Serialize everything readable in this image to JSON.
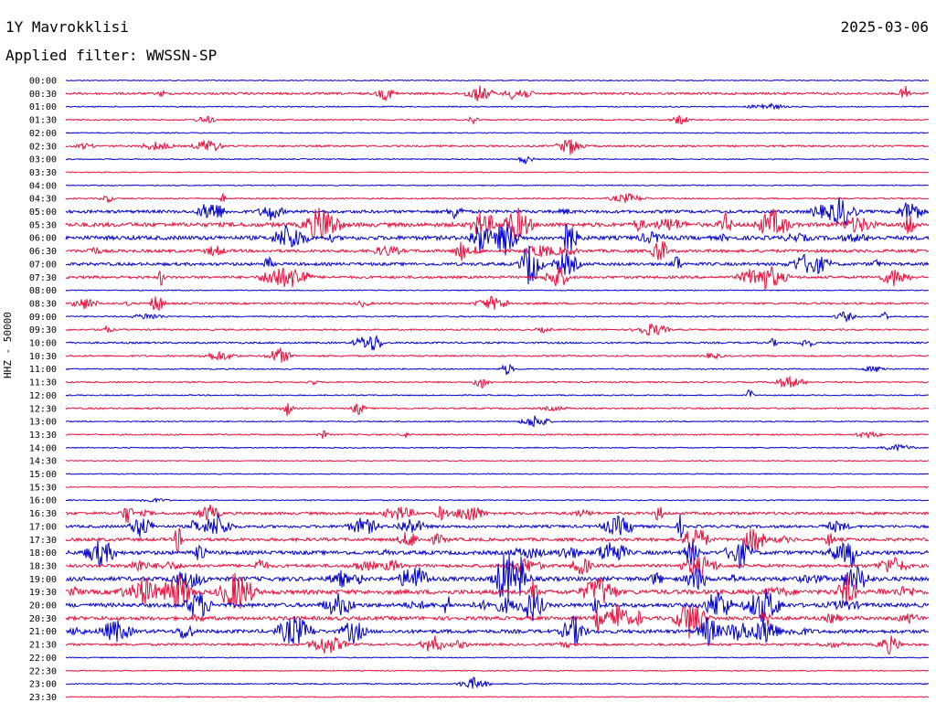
{
  "header": {
    "station": "1Y Mavrokklisi",
    "date": "2025-03-06",
    "filter_label": "Applied filter:",
    "filter_value": "WWSSN-SP"
  },
  "axis": {
    "channel_label": "HHZ - 50000"
  },
  "colors": {
    "trace_a": "#0000cc",
    "trace_b": "#e8103c",
    "background": "#ffffff",
    "text": "#000000"
  },
  "chart_data": {
    "type": "line",
    "title": "1Y Mavrokklisi",
    "subtitle": "Applied filter: WWSSN-SP",
    "ylabel": "HHZ - 50000",
    "trace_colors_alternate": [
      "#0000cc",
      "#e8103c"
    ],
    "ytick_labels": [
      "00:00",
      "00:30",
      "01:00",
      "01:30",
      "02:00",
      "02:30",
      "03:00",
      "03:30",
      "04:00",
      "04:30",
      "05:00",
      "05:30",
      "06:00",
      "06:30",
      "07:00",
      "07:30",
      "08:00",
      "08:30",
      "09:00",
      "09:30",
      "10:00",
      "10:30",
      "11:00",
      "11:30",
      "12:00",
      "12:30",
      "13:00",
      "13:30",
      "14:00",
      "14:30",
      "15:00",
      "15:30",
      "16:00",
      "16:30",
      "17:00",
      "17:30",
      "18:00",
      "18:30",
      "19:00",
      "19:30",
      "20:00",
      "20:30",
      "21:00",
      "21:30",
      "22:00",
      "22:30",
      "23:00",
      "23:30"
    ],
    "activity_level": [
      0.05,
      0.35,
      0.08,
      0.15,
      0.06,
      0.25,
      0.08,
      0.05,
      0.05,
      0.15,
      0.55,
      0.85,
      0.8,
      0.55,
      0.55,
      0.45,
      0.06,
      0.3,
      0.15,
      0.2,
      0.25,
      0.2,
      0.12,
      0.15,
      0.1,
      0.2,
      0.1,
      0.15,
      0.08,
      0.06,
      0.05,
      0.05,
      0.08,
      0.5,
      0.5,
      0.6,
      0.75,
      0.6,
      0.85,
      0.9,
      0.8,
      0.7,
      0.7,
      0.4,
      0.05,
      0.05,
      0.1,
      0.05
    ]
  }
}
